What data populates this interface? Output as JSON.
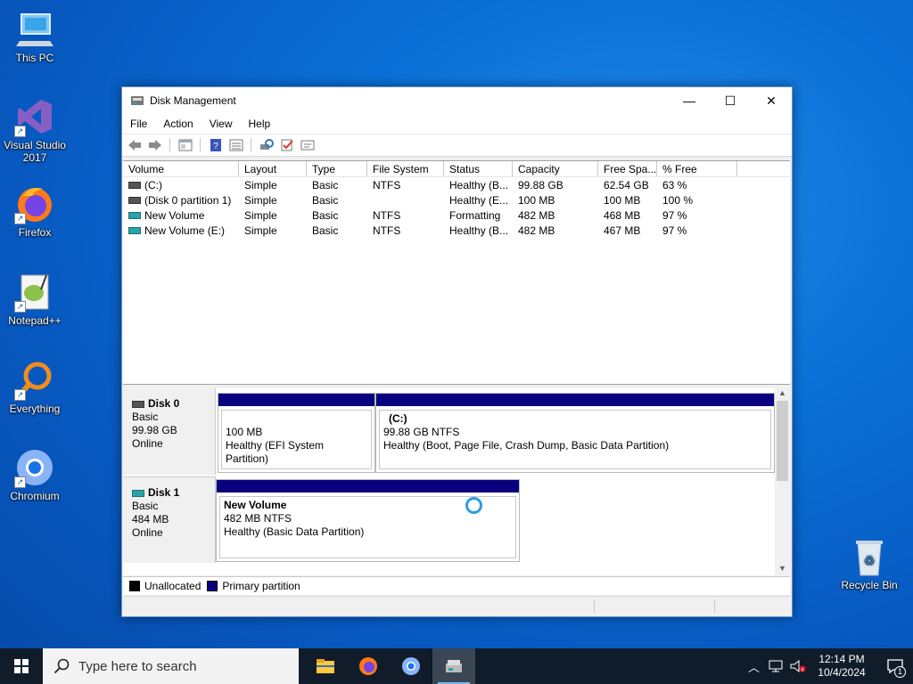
{
  "desktop": {
    "icons": [
      {
        "label": "This PC"
      },
      {
        "label": "Visual Studio 2017"
      },
      {
        "label": "Firefox"
      },
      {
        "label": "Notepad++"
      },
      {
        "label": "Everything"
      },
      {
        "label": "Chromium"
      },
      {
        "label": "Recycle Bin"
      }
    ]
  },
  "window": {
    "title": "Disk Management",
    "controls": {
      "minimize": "—",
      "maximize": "☐",
      "close": "✕"
    },
    "menu": [
      "File",
      "Action",
      "View",
      "Help"
    ],
    "toolbar_icons": [
      "back-icon",
      "forward-icon",
      "properties-icon",
      "help-icon",
      "list-view-icon",
      "rescan-icon",
      "check-icon",
      "settings-icon"
    ]
  },
  "volumes": {
    "columns": [
      "Volume",
      "Layout",
      "Type",
      "File System",
      "Status",
      "Capacity",
      "Free Spa...",
      "% Free"
    ],
    "rows": [
      {
        "volume": "(C:)",
        "layout": "Simple",
        "type": "Basic",
        "fs": "NTFS",
        "status": "Healthy (B...",
        "capacity": "99.88 GB",
        "free": "62.54 GB",
        "pct": "63 %",
        "icon": "gray"
      },
      {
        "volume": "(Disk 0 partition 1)",
        "layout": "Simple",
        "type": "Basic",
        "fs": "",
        "status": "Healthy (E...",
        "capacity": "100 MB",
        "free": "100 MB",
        "pct": "100 %",
        "icon": "gray"
      },
      {
        "volume": "New Volume",
        "layout": "Simple",
        "type": "Basic",
        "fs": "NTFS",
        "status": "Formatting",
        "capacity": "482 MB",
        "free": "468 MB",
        "pct": "97 %",
        "icon": "teal"
      },
      {
        "volume": "New Volume (E:)",
        "layout": "Simple",
        "type": "Basic",
        "fs": "NTFS",
        "status": "Healthy (B...",
        "capacity": "482 MB",
        "free": "467 MB",
        "pct": "97 %",
        "icon": "teal"
      }
    ]
  },
  "disks": {
    "disk0": {
      "name": "Disk 0",
      "type": "Basic",
      "size": "99.98 GB",
      "state": "Online",
      "p1": {
        "name": "",
        "size": "100 MB",
        "status": "Healthy (EFI System Partition)"
      },
      "p2": {
        "name": "(C:)",
        "size": "99.88 GB NTFS",
        "status": "Healthy (Boot, Page File, Crash Dump, Basic Data Partition)"
      }
    },
    "disk1": {
      "name": "Disk 1",
      "type": "Basic",
      "size": "484 MB",
      "state": "Online",
      "p1": {
        "name": "New Volume",
        "size": "482 MB NTFS",
        "status": "Healthy (Basic Data Partition)"
      }
    }
  },
  "legend": {
    "unallocated": "Unallocated",
    "primary": "Primary partition",
    "unallocated_color": "#000000",
    "primary_color": "#08007f"
  },
  "taskbar": {
    "search_placeholder": "Type here to search",
    "time": "12:14 PM",
    "date": "10/4/2024",
    "notification_count": "1"
  }
}
